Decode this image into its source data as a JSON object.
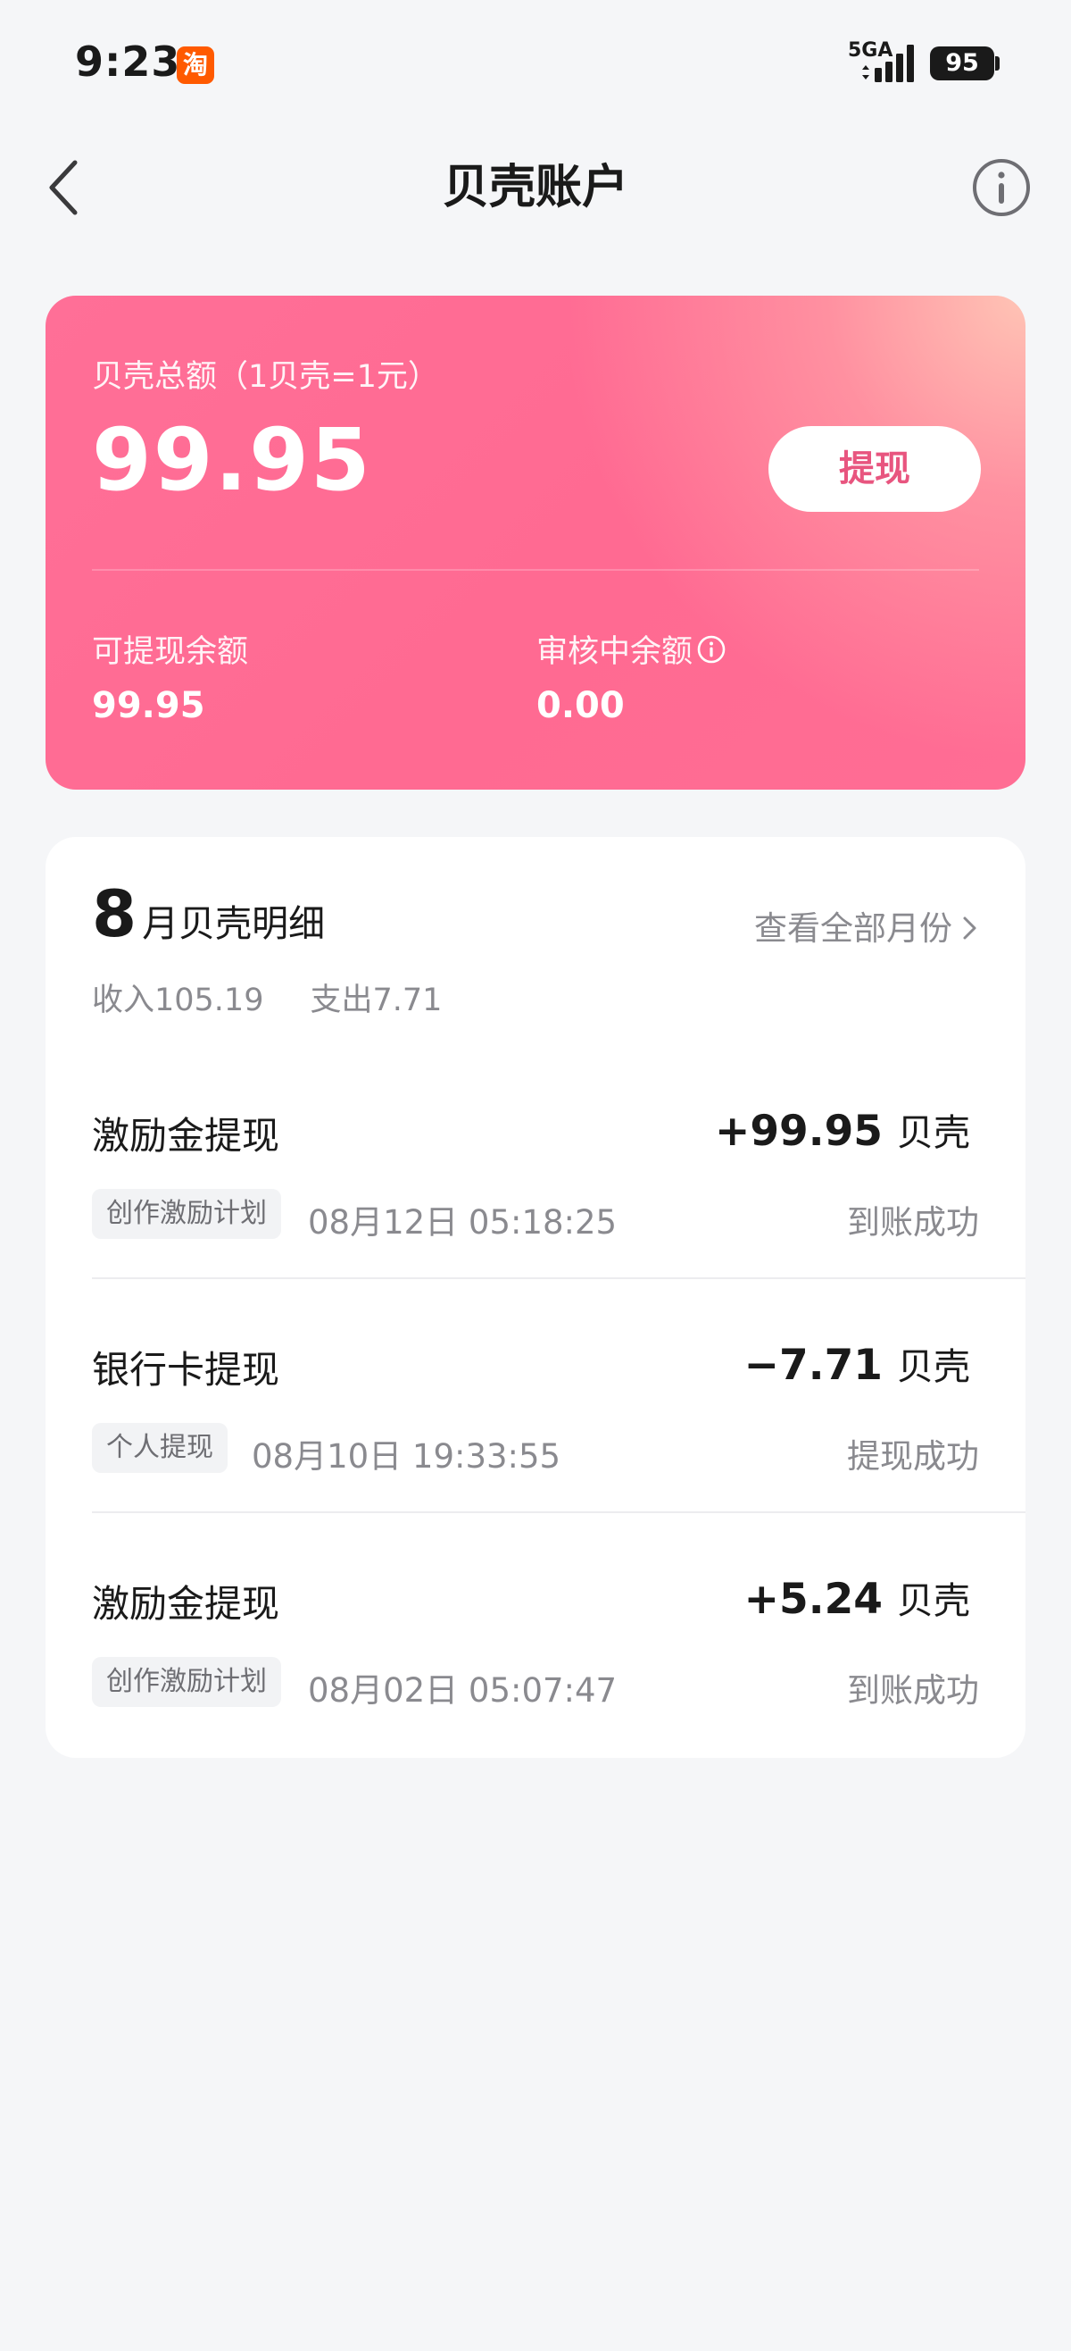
{
  "status_bar": {
    "time": "9:23",
    "app_badge": "淘",
    "network": "5GA",
    "battery": "95"
  },
  "nav": {
    "title": "贝壳账户",
    "back_icon": "chevron-left-icon",
    "info_icon": "info-circle-icon"
  },
  "balance": {
    "label": "贝壳总额（1贝壳=1元）",
    "total": "99.95",
    "withdraw_label": "提现",
    "available_label": "可提现余额",
    "available_value": "99.95",
    "pending_label": "审核中余额",
    "pending_value": "0.00",
    "card_color": "#ff6f97",
    "button_text_color": "#e8557f"
  },
  "details": {
    "month_number": "8",
    "month_title": "月贝壳明细",
    "view_all_label": "查看全部月份",
    "income_label": "收入105.19",
    "expense_label": "支出7.71",
    "transactions": [
      {
        "title": "激励金提现",
        "amount": "+99.95",
        "unit": "贝壳",
        "tag": "创作激励计划",
        "time": "08月12日 05:18:25",
        "status": "到账成功"
      },
      {
        "title": "银行卡提现",
        "amount": "−7.71",
        "unit": "贝壳",
        "tag": "个人提现",
        "time": "08月10日 19:33:55",
        "status": "提现成功"
      },
      {
        "title": "激励金提现",
        "amount": "+5.24",
        "unit": "贝壳",
        "tag": "创作激励计划",
        "time": "08月02日 05:07:47",
        "status": "到账成功"
      }
    ]
  }
}
